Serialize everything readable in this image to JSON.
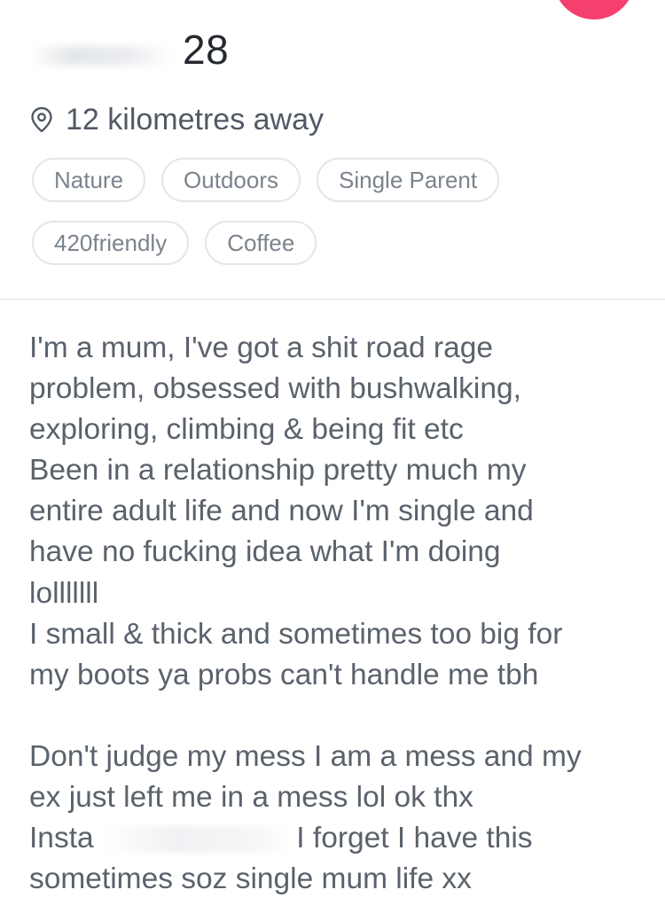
{
  "colors": {
    "accent": "#f5406f",
    "text": "#505965",
    "chip_border": "#e2e5e9"
  },
  "profile": {
    "name_hidden": true,
    "age": "28",
    "distance": "12 kilometres away",
    "location_icon": "location-pin-icon"
  },
  "passions": [
    "Nature",
    "Outdoors",
    "Single Parent",
    "420friendly",
    "Coffee"
  ],
  "bio": {
    "lines": [
      "I'm a mum, I've got a shit road rage",
      "problem, obsessed with bushwalking,",
      "exploring, climbing & being fit etc",
      "Been in a relationship pretty much my",
      "entire adult life and now I'm single and",
      "have no fucking idea what I'm doing",
      "lolllllll",
      "I small & thick and sometimes too big for",
      "my boots ya probs can't handle me tbh",
      "",
      "Don't judge my mess I am a mess and my",
      "ex just left me in a mess lol ok thx"
    ],
    "insta_label": "Insta",
    "insta_tail": "I forget I have this",
    "last_line": "sometimes soz single mum life xx"
  }
}
